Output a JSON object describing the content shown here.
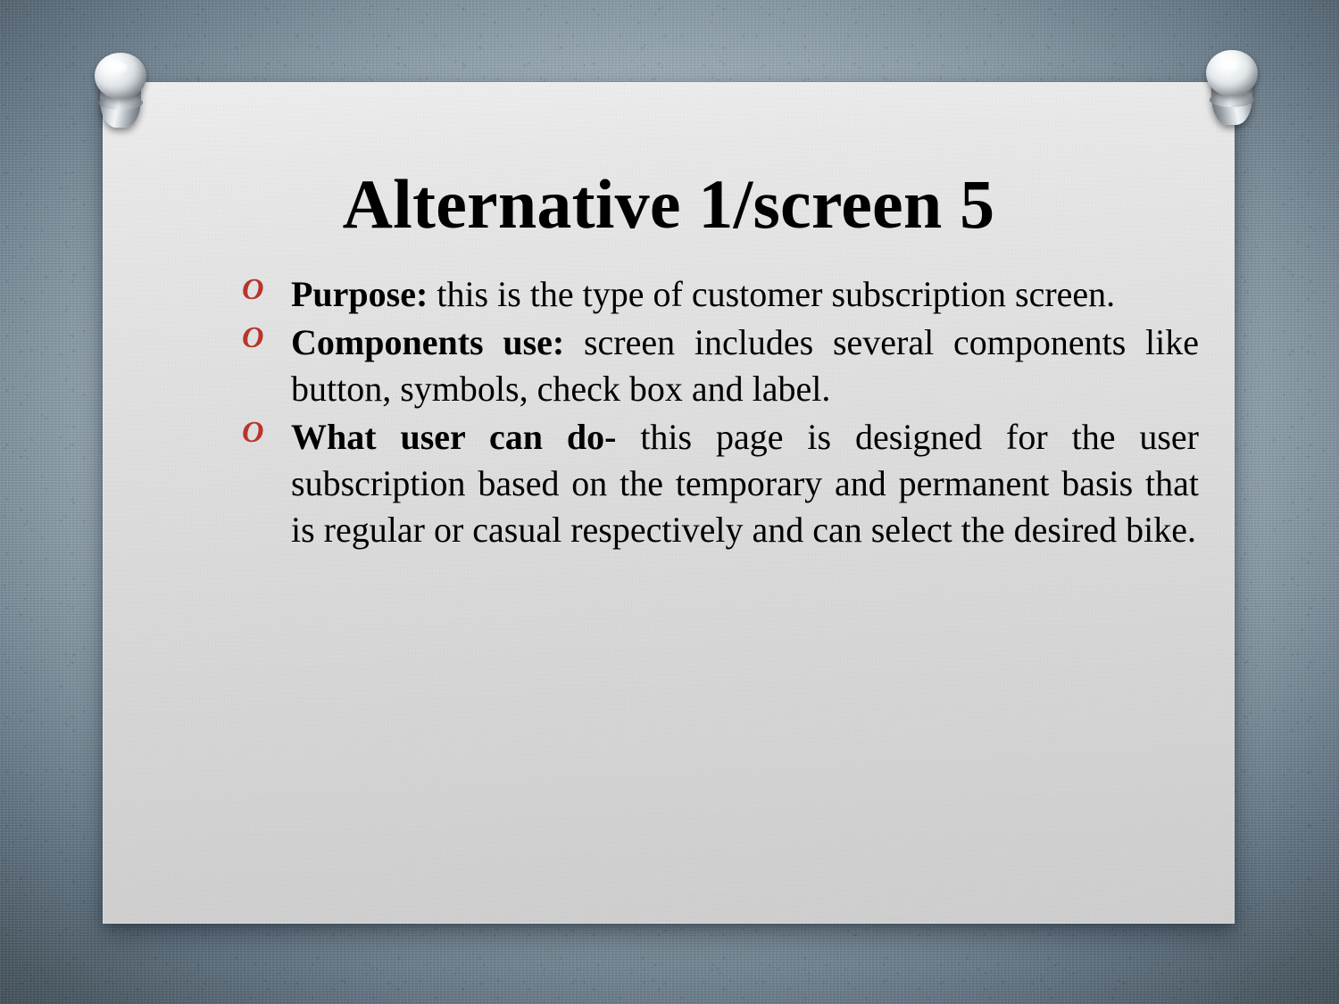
{
  "slide": {
    "title": "Alternative 1/screen 5",
    "background_color": "#a9bac6",
    "card_color": "#e0e0e0",
    "bullet_marker_color": "#b8352c",
    "text_color": "#000000",
    "pin_left_icon": "pushpin-icon",
    "pin_right_icon": "pushpin-icon",
    "bullet_marker_glyph": "O",
    "bullets": [
      {
        "marker": "O",
        "lead": "Purpose:",
        "body": " this is the type of customer subscription screen."
      },
      {
        "marker": "O",
        "lead": "Components use:",
        "body": " screen includes several components like button, symbols, check box and label."
      },
      {
        "marker": "O",
        "lead": "What user can do-",
        "body": " this page is designed for the user subscription based on the temporary and permanent basis that is regular or casual respectively and can select the desired bike."
      }
    ]
  }
}
